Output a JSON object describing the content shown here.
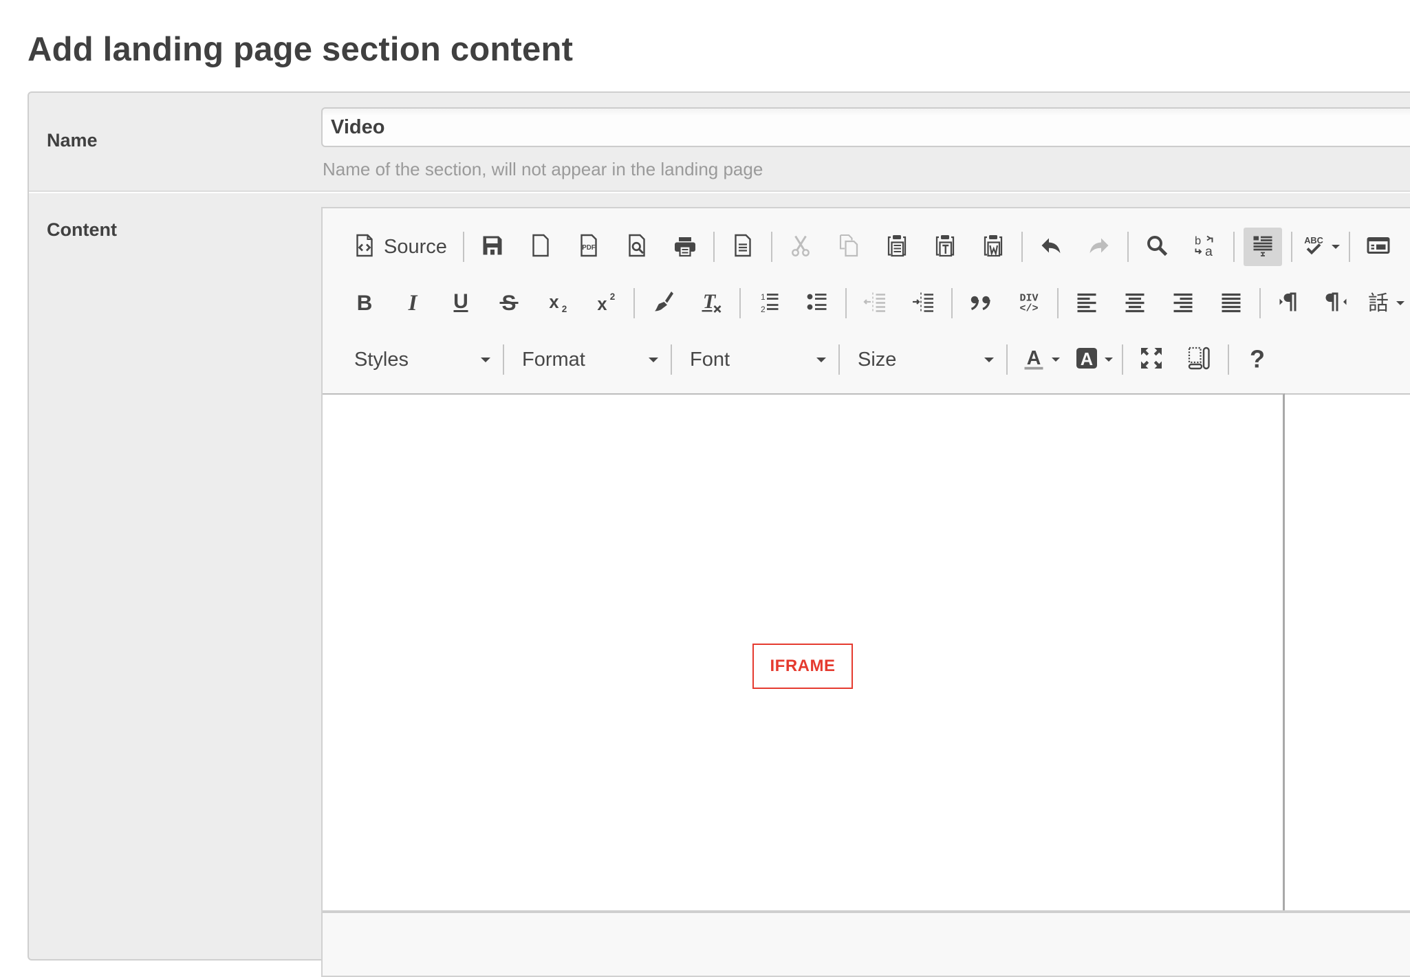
{
  "page": {
    "title": "Add landing page section content"
  },
  "form": {
    "name": {
      "label": "Name",
      "value": "Video",
      "help": "Name of the section, will not appear in the landing page"
    },
    "content": {
      "label": "Content"
    }
  },
  "editor": {
    "toolbar": {
      "row1": [
        {
          "id": "source",
          "label": "Source",
          "icon": "source-icon"
        },
        {
          "id": "save",
          "icon": "save-icon"
        },
        {
          "id": "new-page",
          "icon": "new-page-icon"
        },
        {
          "id": "export-pdf",
          "icon": "pdf-icon"
        },
        {
          "id": "preview",
          "icon": "preview-icon"
        },
        {
          "id": "print",
          "icon": "print-icon"
        },
        {
          "id": "templates",
          "icon": "templates-icon"
        },
        {
          "id": "cut",
          "icon": "cut-icon",
          "disabled": true
        },
        {
          "id": "copy",
          "icon": "copy-icon",
          "disabled": true
        },
        {
          "id": "paste",
          "icon": "paste-icon"
        },
        {
          "id": "paste-text",
          "icon": "paste-text-icon"
        },
        {
          "id": "paste-word",
          "icon": "paste-word-icon"
        },
        {
          "id": "undo",
          "icon": "undo-icon"
        },
        {
          "id": "redo",
          "icon": "redo-icon",
          "disabled": true
        },
        {
          "id": "find",
          "icon": "find-icon"
        },
        {
          "id": "replace",
          "icon": "replace-icon"
        },
        {
          "id": "select-all",
          "icon": "select-all-icon",
          "active": true
        },
        {
          "id": "spellcheck",
          "icon": "spellcheck-icon",
          "dropdown": true
        },
        {
          "id": "form",
          "icon": "form-icon"
        }
      ],
      "row2": [
        {
          "id": "bold",
          "icon": "bold-icon"
        },
        {
          "id": "italic",
          "icon": "italic-icon"
        },
        {
          "id": "underline",
          "icon": "underline-icon"
        },
        {
          "id": "strike",
          "icon": "strikethrough-icon"
        },
        {
          "id": "subscript",
          "icon": "subscript-icon"
        },
        {
          "id": "superscript",
          "icon": "superscript-icon"
        },
        {
          "id": "copy-format",
          "icon": "paintbrush-icon"
        },
        {
          "id": "remove-format",
          "icon": "remove-format-icon"
        },
        {
          "id": "numbered-list",
          "icon": "numbered-list-icon"
        },
        {
          "id": "bulleted-list",
          "icon": "bulleted-list-icon"
        },
        {
          "id": "outdent",
          "icon": "outdent-icon",
          "disabled": true
        },
        {
          "id": "indent",
          "icon": "indent-icon"
        },
        {
          "id": "blockquote",
          "icon": "blockquote-icon"
        },
        {
          "id": "div",
          "icon": "div-container-icon"
        },
        {
          "id": "align-left",
          "icon": "align-left-icon"
        },
        {
          "id": "align-center",
          "icon": "align-center-icon"
        },
        {
          "id": "align-right",
          "icon": "align-right-icon"
        },
        {
          "id": "justify",
          "icon": "justify-icon"
        },
        {
          "id": "ltr",
          "icon": "text-direction-ltr-icon"
        },
        {
          "id": "rtl",
          "icon": "text-direction-rtl-icon"
        },
        {
          "id": "language",
          "icon": "language-icon",
          "dropdown": true
        }
      ],
      "row3": {
        "combos": [
          {
            "id": "styles",
            "label": "Styles"
          },
          {
            "id": "format",
            "label": "Format"
          },
          {
            "id": "font",
            "label": "Font"
          },
          {
            "id": "size",
            "label": "Size"
          }
        ],
        "buttons": [
          {
            "id": "text-color",
            "icon": "text-color-icon",
            "dropdown": true
          },
          {
            "id": "bg-color",
            "icon": "background-color-icon",
            "dropdown": true
          },
          {
            "id": "maximize",
            "icon": "maximize-icon"
          },
          {
            "id": "show-blocks",
            "icon": "show-blocks-icon"
          },
          {
            "id": "about",
            "icon": "help-icon"
          }
        ]
      }
    },
    "body": {
      "placeholder_label": "IFRAME"
    },
    "colors": {
      "iframe_accent": "#e53a2f",
      "icon": "#474747",
      "icon_disabled": "#bdbdbd"
    }
  }
}
